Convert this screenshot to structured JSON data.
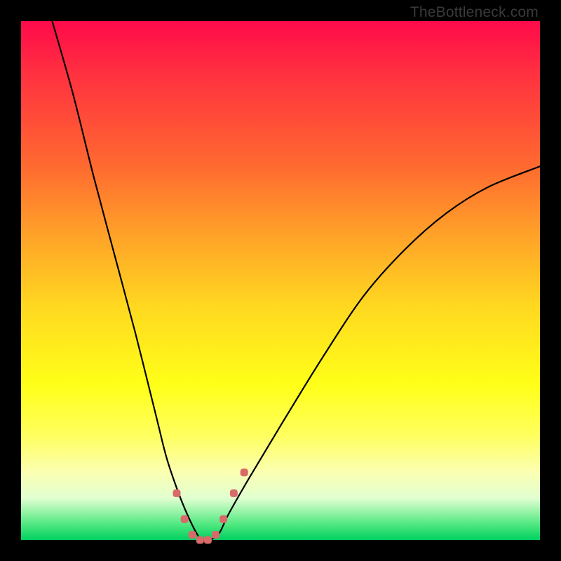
{
  "watermark": {
    "text": "TheBottleneck.com"
  },
  "chart_data": {
    "type": "line",
    "title": "",
    "xlabel": "",
    "ylabel": "",
    "xlim": [
      0,
      100
    ],
    "ylim": [
      0,
      100
    ],
    "grid": false,
    "legend": false,
    "series": [
      {
        "name": "bottleneck-curve",
        "x": [
          6,
          10,
          14,
          18,
          22,
          26,
          28,
          30,
          32,
          34,
          35,
          36,
          38,
          40,
          44,
          50,
          58,
          66,
          74,
          82,
          90,
          100
        ],
        "y": [
          100,
          86,
          70,
          55,
          40,
          24,
          16,
          10,
          5,
          1,
          0,
          0,
          1,
          5,
          12,
          22,
          35,
          47,
          56,
          63,
          68,
          72
        ]
      }
    ],
    "markers": {
      "name": "highlight-dots",
      "x": [
        30,
        31.5,
        33,
        34.5,
        36,
        37.5,
        39,
        41,
        43
      ],
      "y": [
        9,
        4,
        1,
        0,
        0,
        1,
        4,
        9,
        13
      ],
      "color": "#d96a6a",
      "size": 11
    }
  }
}
